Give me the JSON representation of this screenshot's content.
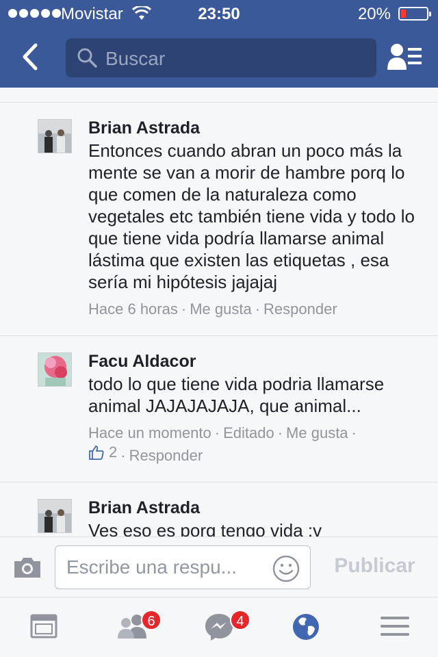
{
  "status_bar": {
    "carrier": "Movistar",
    "time": "23:50",
    "battery_pct": "20%",
    "battery_level": 0.2,
    "battery_color": "#ff3b30"
  },
  "navbar": {
    "back_icon": "chevron-left-icon",
    "search_placeholder": "Buscar",
    "friends_icon": "friend-requests-icon",
    "bg_color": "#3b5998"
  },
  "comments": [
    {
      "author": "Brian Astrada",
      "text": "Entonces cuando abran un poco  más la mente se van a morir de hambre porq lo que comen de la naturaleza como vegetales etc también tiene vida y todo lo que tiene vida podría llamarse animal lástima que existen las etiquetas , esa sería mi hipótesis jajajaj",
      "time": "Hace 6 horas",
      "like": "Me gusta",
      "reply": "Responder"
    },
    {
      "author": "Facu Aldacor",
      "text": "todo lo que tiene vida podria llamarse animal JAJAJAJAJA, que animal...",
      "time": "Hace un momento",
      "edited": "Editado",
      "like": "Me gusta",
      "like_count": "2",
      "reply": "Responder"
    },
    {
      "author": "Brian Astrada",
      "text": "Ves eso es porq tengo vida :v"
    }
  ],
  "reply_bar": {
    "placeholder": "Escribe una respu...",
    "publish_label": "Publicar"
  },
  "tab_bar": {
    "items": [
      {
        "icon": "news-feed-icon"
      },
      {
        "icon": "friends-icon",
        "badge": "6"
      },
      {
        "icon": "messenger-icon",
        "badge": "4"
      },
      {
        "icon": "globe-icon"
      },
      {
        "icon": "menu-icon"
      }
    ],
    "active_color": "#4267b2"
  }
}
